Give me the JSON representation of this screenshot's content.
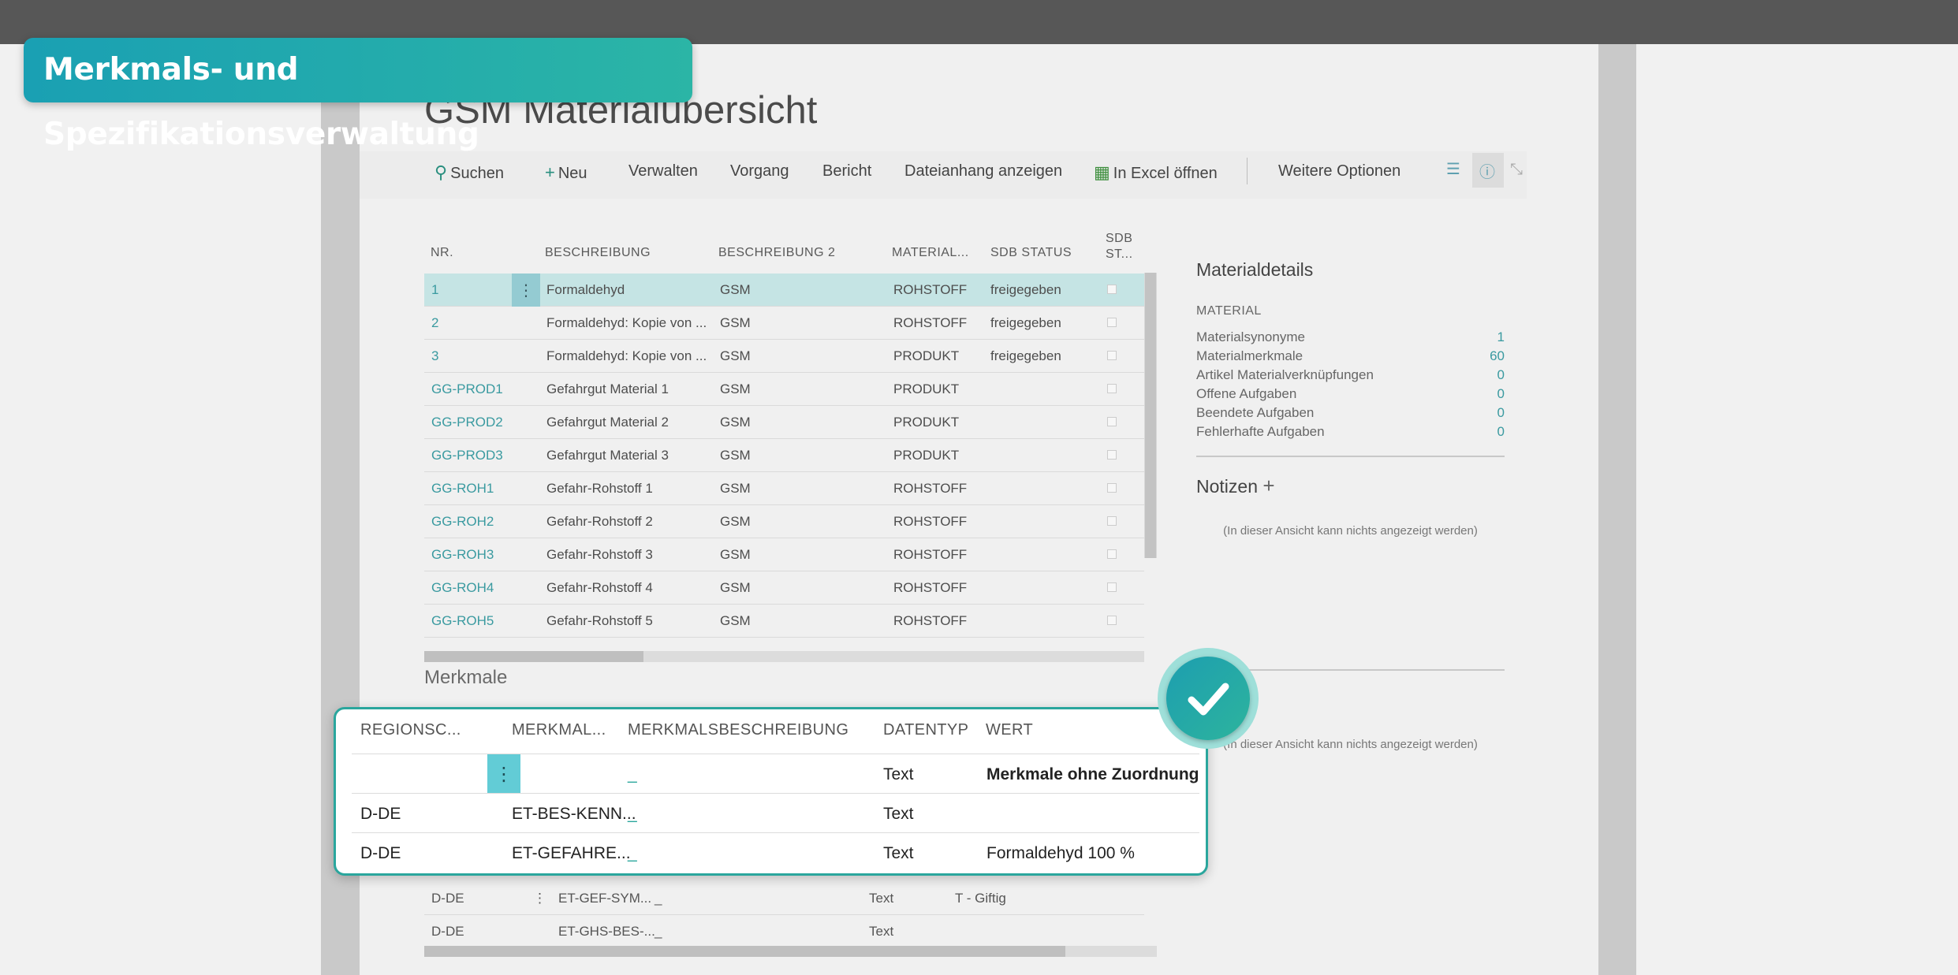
{
  "banner": {
    "title": "Merkmals- und Spezifikationsverwaltung"
  },
  "page": {
    "title": "GSM Materialübersicht"
  },
  "actions": {
    "search": "Suchen",
    "new": "Neu",
    "manage": "Verwalten",
    "process": "Vorgang",
    "report": "Bericht",
    "attachment": "Dateianhang anzeigen",
    "excel": "In Excel öffnen",
    "more": "Weitere Optionen"
  },
  "material_table": {
    "headers": {
      "nr": "NR.",
      "desc": "BESCHREIBUNG",
      "desc2": "BESCHREIBUNG 2",
      "material": "MATERIAL...",
      "sdb_status": "SDB STATUS",
      "sdb_st_1": "SDB",
      "sdb_st_2": "ST..."
    },
    "rows": [
      {
        "nr": "1",
        "desc": "Formaldehyd",
        "desc2": "GSM",
        "material": "ROHSTOFF",
        "status": "freigegeben"
      },
      {
        "nr": "2",
        "desc": "Formaldehyd: Kopie von ...",
        "desc2": "GSM",
        "material": "ROHSTOFF",
        "status": "freigegeben"
      },
      {
        "nr": "3",
        "desc": "Formaldehyd: Kopie von ...",
        "desc2": "GSM",
        "material": "PRODUKT",
        "status": "freigegeben"
      },
      {
        "nr": "GG-PROD1",
        "desc": "Gefahrgut Material 1",
        "desc2": "GSM",
        "material": "PRODUKT",
        "status": ""
      },
      {
        "nr": "GG-PROD2",
        "desc": "Gefahrgut Material 2",
        "desc2": "GSM",
        "material": "PRODUKT",
        "status": ""
      },
      {
        "nr": "GG-PROD3",
        "desc": "Gefahrgut Material 3",
        "desc2": "GSM",
        "material": "PRODUKT",
        "status": ""
      },
      {
        "nr": "GG-ROH1",
        "desc": "Gefahr-Rohstoff 1",
        "desc2": "GSM",
        "material": "ROHSTOFF",
        "status": ""
      },
      {
        "nr": "GG-ROH2",
        "desc": "Gefahr-Rohstoff 2",
        "desc2": "GSM",
        "material": "ROHSTOFF",
        "status": ""
      },
      {
        "nr": "GG-ROH3",
        "desc": "Gefahr-Rohstoff 3",
        "desc2": "GSM",
        "material": "ROHSTOFF",
        "status": ""
      },
      {
        "nr": "GG-ROH4",
        "desc": "Gefahr-Rohstoff 4",
        "desc2": "GSM",
        "material": "ROHSTOFF",
        "status": ""
      },
      {
        "nr": "GG-ROH5",
        "desc": "Gefahr-Rohstoff 5",
        "desc2": "GSM",
        "material": "ROHSTOFF",
        "status": ""
      }
    ]
  },
  "details": {
    "title": "Materialdetails",
    "section": "MATERIAL",
    "items": [
      {
        "label": "Materialsynonyme",
        "value": "1"
      },
      {
        "label": "Materialmerkmale",
        "value": "60"
      },
      {
        "label": "Artikel Materialverknüpfungen",
        "value": "0"
      },
      {
        "label": "Offene Aufgaben",
        "value": "0"
      },
      {
        "label": "Beendete Aufgaben",
        "value": "0"
      },
      {
        "label": "Fehlerhafte Aufgaben",
        "value": "0"
      }
    ],
    "notes_title": "Notizen",
    "empty_text": "(In dieser Ansicht kann nichts angezeigt werden)"
  },
  "merkmale": {
    "title": "Merkmale",
    "headers": {
      "region": "REGIONSC...",
      "merkmal": "MERKMAL...",
      "desc": "MERKMALSBESCHREIBUNG",
      "type": "DATENTYP",
      "value": "WERT"
    },
    "rows": [
      {
        "region": "",
        "merkmal": "",
        "desc": "_",
        "type": "Text",
        "value": "Merkmale ohne Zuordnung"
      },
      {
        "region": "D-DE",
        "merkmal": "ET-BES-KENN...",
        "desc": "_",
        "type": "Text",
        "value": ""
      },
      {
        "region": "D-DE",
        "merkmal": "ET-GEFAHRE...",
        "desc": "_",
        "type": "Text",
        "value": "Formaldehyd 100 %"
      }
    ],
    "lower_rows": [
      {
        "region": "D-DE",
        "merkmal": "ET-GEF-SYM...",
        "desc": "_",
        "type": "Text",
        "value": "T - Giftig"
      },
      {
        "region": "D-DE",
        "merkmal": "ET-GHS-BES-...",
        "desc": "_",
        "type": "Text",
        "value": ""
      }
    ]
  },
  "colors": {
    "accent": "#2aa69d",
    "link": "#3a9aa0",
    "selection": "#c5e4e4"
  }
}
